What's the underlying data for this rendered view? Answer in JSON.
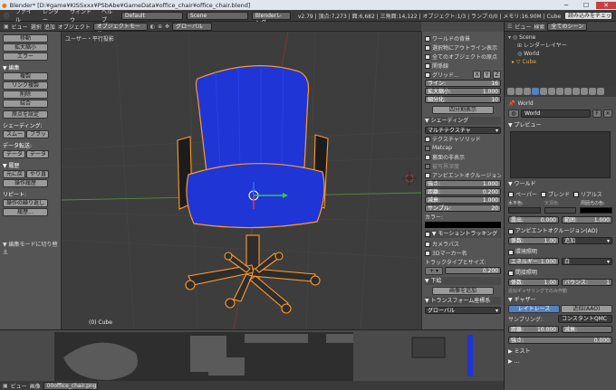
{
  "window": {
    "title": "Blender* [D:¥game¥KISSxxx¥PSbAbe¥GameData¥office_chair¥office_chair.blend]",
    "minimize": "─",
    "maximize": "☐",
    "close": "✕"
  },
  "menubar": {
    "items": [
      "ファイル",
      "レンダー",
      "ウィンドウ",
      "ヘルプ"
    ],
    "layout": "Default",
    "scene": "Scene",
    "engine": "Blenderレンダー",
    "stats": "v2.79 | 頂点:7,273 | 面:6,682 | 三角面:14,122 | オブジェクト:1/3 | ランプ:0/0 | メモリ:16.90M | Cube",
    "check_button": "読み込みをチェック"
  },
  "viewport_header": {
    "view": "ビュー",
    "select": "選択",
    "add": "追加",
    "object": "オブジェクト",
    "mode": "オブジェクトモード",
    "pivot": "グローバル"
  },
  "viewport": {
    "label": "ユーザー・平行投影",
    "object_label": "(0) Cube"
  },
  "toolshelf": {
    "top_buttons": [
      "移動",
      "拡大縮小",
      "エラー"
    ],
    "edit_title": "▼ 編集",
    "edit_buttons": [
      "複製",
      "リンク複製",
      "削除",
      "結合"
    ],
    "origin": "原点を設定",
    "shading_title": "シェーディング:",
    "shading_pair": [
      "スムー",
      "フラット"
    ],
    "data_title": "データ転送:",
    "data_pair": [
      "データ",
      "データ"
    ],
    "history_title": "▼ 履歴",
    "history_pair": [
      "元に戻",
      "やり直す"
    ],
    "history_buttons": [
      "操作履歴"
    ],
    "repeat_title": "リピート:",
    "repeat_buttons": [
      "操作の繰り返し",
      "履歴..."
    ],
    "footer": "▼ 編集モードに切り替え"
  },
  "npanel": {
    "checks": [
      "ワールドの背景",
      "選択物にアウトライン表示",
      "全てのオブジェクトの原点",
      "関係線"
    ],
    "grid_label": "グリッド...",
    "axes": [
      "X",
      "Y",
      "Z"
    ],
    "fields": [
      {
        "label": "ライン:",
        "value": "16"
      },
      {
        "label": "拡大縮小:",
        "value": "1.000"
      },
      {
        "label": "細分化:",
        "value": "10"
      }
    ],
    "toggle_quad": "四分割表示",
    "shading_title": "▼ シェーディング",
    "shading_mode": "マルチテクスチャ",
    "shading_checks": [
      "テクスチャソリッド",
      "Matcap",
      "裏面の非表示",
      "被写界深度",
      "アンビエントオクルージョン"
    ],
    "ao_fields": [
      {
        "label": "強さ:",
        "value": "1.000"
      },
      {
        "label": "距離:",
        "value": "0.200"
      },
      {
        "label": "減衰:",
        "value": "1.000"
      },
      {
        "label": "サンプル:",
        "value": "20"
      }
    ],
    "color_label": "カラー:",
    "motion_title": "▼ モーショントラッキング",
    "motion_checks": [
      "カメラパス",
      "3Dマーカー名"
    ],
    "track_label": "トラックタイプとサイズ:",
    "track_value": "0.200",
    "bg_title": "▼ 下絵",
    "add_image": "画像を追加",
    "transform_title": "▼ トランスフォーム座標系",
    "transform_value": "グローバル"
  },
  "outliner": {
    "view": "ビュー",
    "search": "検索",
    "scenes": "全てのシーン",
    "items": [
      "Scene",
      "レンダーレイヤー",
      "World",
      "Cube"
    ]
  },
  "properties": {
    "context": "World",
    "world_name": "World",
    "preview_title": "▼ プレビュー",
    "world_title": "▼ ワールド",
    "world_checks": [
      "ペーパー",
      "ブレンド",
      "リアルス"
    ],
    "color_labels": [
      "水平色:",
      "天頂色:",
      "周囲光の色:"
    ],
    "exposure": {
      "label": "露出:",
      "value": "0.000"
    },
    "range": {
      "label": "範囲:",
      "value": "1.000"
    },
    "ao_title": "アンビエントオクルージョン(AO)",
    "ao_fields": [
      {
        "label": "係数:",
        "value": "1.00"
      },
      {
        "label": "",
        "value": "追加"
      }
    ],
    "env_title": "環境照明",
    "env_fields": [
      {
        "label": "エネルギー:",
        "value": "1.000"
      },
      {
        "label": "",
        "value": "白"
      }
    ],
    "indirect_title": "間接照明",
    "indirect_fields": [
      {
        "label": "係数:",
        "value": "1.00"
      },
      {
        "label": "バウンス:",
        "value": "1"
      }
    ],
    "indirect_note": "近似ギャザリングでのみ作動",
    "gather_title": "▼ ギャザー",
    "gather_tabs": [
      "レイトレース",
      "近似(AAO)"
    ],
    "gather_labels": [
      "サンプリング:",
      "コンスタントQMC"
    ],
    "gather_fields": [
      {
        "label": "距離:",
        "value": "10.000"
      },
      {
        "label": "減衰:",
        "value": ""
      },
      {
        "label": "強さ:",
        "value": "0.000"
      }
    ],
    "mist_title": "▶ ミスト",
    "more_title": "▶ ..."
  },
  "statusbar": {
    "file": "00office_chair.png",
    "items": [
      "ビュー",
      "画像"
    ]
  },
  "colors": {
    "accent": "#5680c2",
    "chair": "#1f35d6",
    "selection": "#ff9a2e",
    "grid_x": "#8c3a3a",
    "grid_y": "#5a8a3a"
  }
}
